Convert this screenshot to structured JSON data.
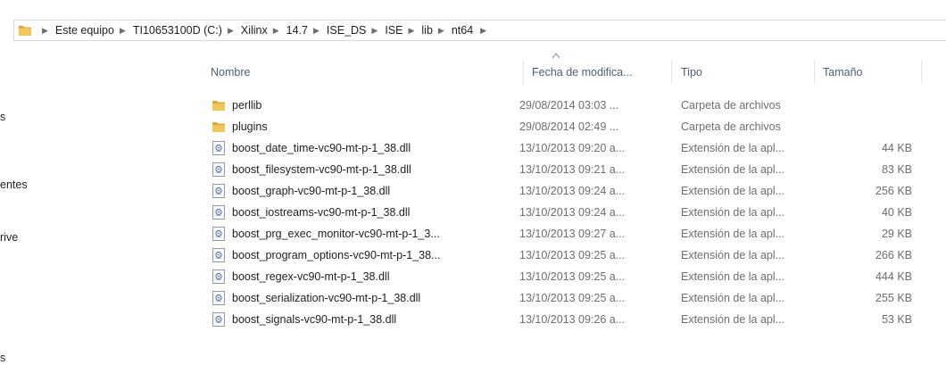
{
  "breadcrumb": [
    "Este equipo",
    "TI10653100D (C:)",
    "Xilinx",
    "14.7",
    "ISE_DS",
    "ISE",
    "lib",
    "nt64"
  ],
  "nav_pane": {
    "items": [
      {
        "label": "s"
      },
      {
        "label": "entes"
      },
      {
        "label": "rive"
      },
      {
        "label": "s"
      }
    ]
  },
  "columns": {
    "name": "Nombre",
    "date": "Fecha de modifica...",
    "type": "Tipo",
    "size": "Tamaño"
  },
  "files": [
    {
      "name": "perllib",
      "date": "29/08/2014 03:03 ...",
      "type": "Carpeta de archivos",
      "size": "",
      "icon": "folder-icon"
    },
    {
      "name": "plugins",
      "date": "29/08/2014 02:49 ...",
      "type": "Carpeta de archivos",
      "size": "",
      "icon": "folder-icon"
    },
    {
      "name": "boost_date_time-vc90-mt-p-1_38.dll",
      "date": "13/10/2013 09:20 a...",
      "type": "Extensión de la apl...",
      "size": "44 KB",
      "icon": "dll-file-icon"
    },
    {
      "name": "boost_filesystem-vc90-mt-p-1_38.dll",
      "date": "13/10/2013 09:21 a...",
      "type": "Extensión de la apl...",
      "size": "83 KB",
      "icon": "dll-file-icon"
    },
    {
      "name": "boost_graph-vc90-mt-p-1_38.dll",
      "date": "13/10/2013 09:24 a...",
      "type": "Extensión de la apl...",
      "size": "256 KB",
      "icon": "dll-file-icon"
    },
    {
      "name": "boost_iostreams-vc90-mt-p-1_38.dll",
      "date": "13/10/2013 09:24 a...",
      "type": "Extensión de la apl...",
      "size": "40 KB",
      "icon": "dll-file-icon"
    },
    {
      "name": "boost_prg_exec_monitor-vc90-mt-p-1_3...",
      "date": "13/10/2013 09:27 a...",
      "type": "Extensión de la apl...",
      "size": "29 KB",
      "icon": "dll-file-icon"
    },
    {
      "name": "boost_program_options-vc90-mt-p-1_38...",
      "date": "13/10/2013 09:25 a...",
      "type": "Extensión de la apl...",
      "size": "266 KB",
      "icon": "dll-file-icon"
    },
    {
      "name": "boost_regex-vc90-mt-p-1_38.dll",
      "date": "13/10/2013 09:25 a...",
      "type": "Extensión de la apl...",
      "size": "444 KB",
      "icon": "dll-file-icon"
    },
    {
      "name": "boost_serialization-vc90-mt-p-1_38.dll",
      "date": "13/10/2013 09:25 a...",
      "type": "Extensión de la apl...",
      "size": "255 KB",
      "icon": "dll-file-icon"
    },
    {
      "name": "boost_signals-vc90-mt-p-1_38.dll",
      "date": "13/10/2013 09:26 a...",
      "type": "Extensión de la apl...",
      "size": "53 KB",
      "icon": "dll-file-icon"
    }
  ],
  "colors": {
    "folder": "#e8b84a",
    "header_text": "#4c607a",
    "muted_text": "#6d6d6d"
  }
}
